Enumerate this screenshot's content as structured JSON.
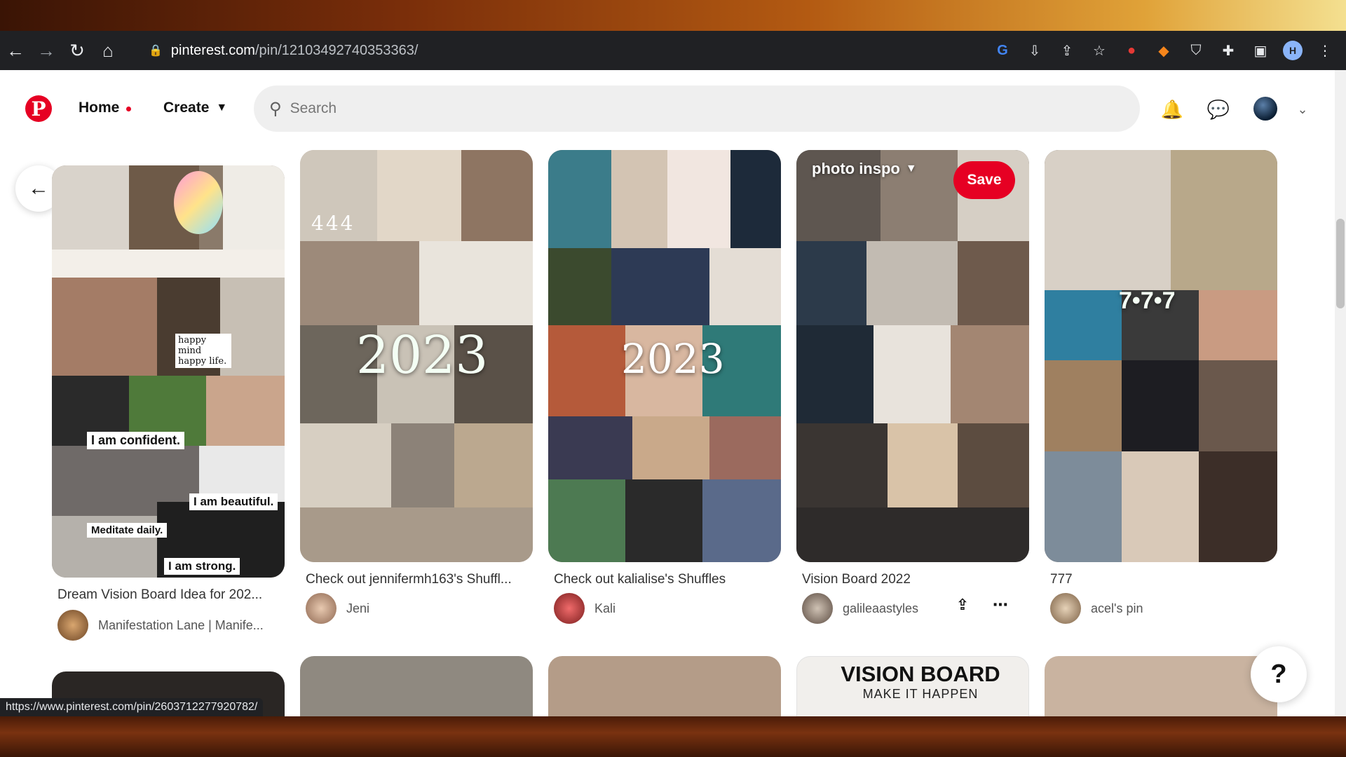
{
  "browser": {
    "url_host": "pinterest.com",
    "url_path": "/pin/12103492740353363/",
    "status_url": "https://www.pinterest.com/pin/2603712277920782/"
  },
  "header": {
    "home_label": "Home",
    "create_label": "Create",
    "search_placeholder": "Search"
  },
  "pins": [
    {
      "caption": "Dream Vision Board Idea for 202...",
      "author": "Manifestation Lane | Manife...",
      "text": ""
    },
    {
      "caption": "Check out jennifermh163's Shuffl...",
      "author": "Jeni",
      "text": "2023"
    },
    {
      "caption": "Check out kalialise's Shuffles",
      "author": "Kali",
      "text": "2023"
    },
    {
      "caption": "Vision Board 2022",
      "author": "galileaastyles",
      "board": "photo inspo",
      "save": "Save"
    },
    {
      "caption": "777",
      "author": "acel's pin",
      "text": "7•7•7"
    }
  ],
  "small_text": {
    "p1_confident": "I am confident.",
    "p1_beautiful": "I am beautiful.",
    "p1_strong": "I am strong.",
    "p1_meditate": "Meditate daily.",
    "p1_happy": "happy mind happy life.",
    "p2_444": "444"
  },
  "vision_board": {
    "title": "VISION BOARD",
    "subtitle": "MAKE IT HAPPEN"
  },
  "help_label": "?"
}
